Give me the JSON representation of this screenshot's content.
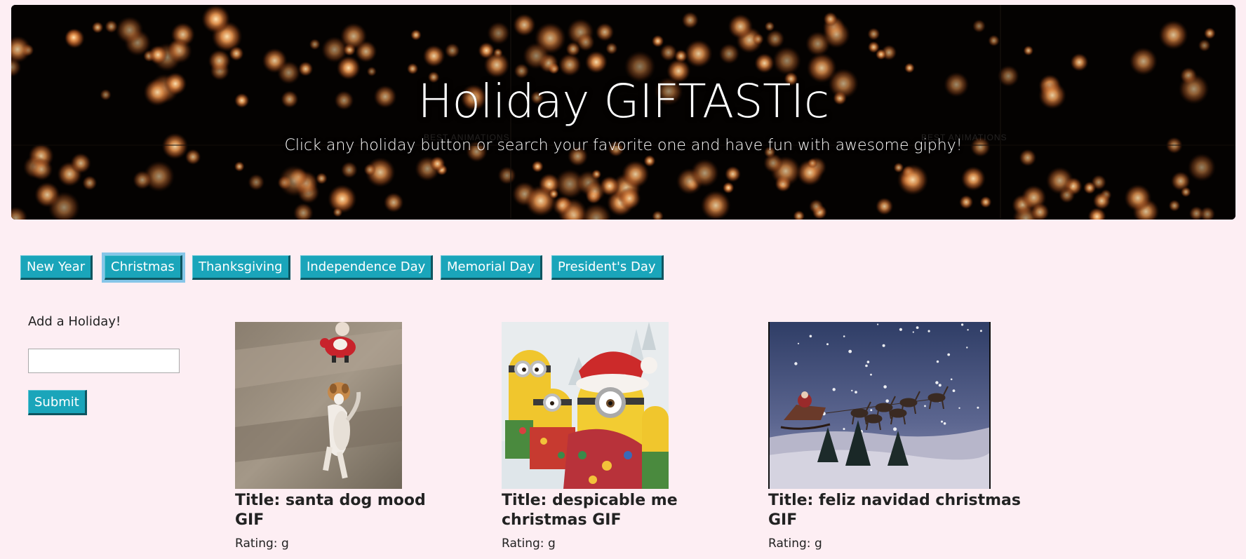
{
  "header": {
    "title": "Holiday GIFTASTIc",
    "subtitle": "Click any holiday button or search your favorite one and have fun with awesome giphy!",
    "watermark_text": "BEST ANIMATIONS",
    "background": "fireworks"
  },
  "holiday_buttons": [
    {
      "label": "New Year",
      "active": false
    },
    {
      "label": "Christmas",
      "active": true
    },
    {
      "label": "Thanksgiving",
      "active": false
    },
    {
      "label": "Independence Day",
      "active": false
    },
    {
      "label": "Memorial Day",
      "active": false
    },
    {
      "label": "President's Day",
      "active": false
    }
  ],
  "form": {
    "label": "Add a Holiday!",
    "input_value": "",
    "submit_label": "Submit"
  },
  "gifs": [
    {
      "title": "Title: santa dog mood GIF",
      "rating": "Rating: g",
      "image": "dog-chasing-santa-toy"
    },
    {
      "title": "Title: despicable me christmas GIF",
      "rating": "Rating: g",
      "image": "minions-in-christmas-outfits"
    },
    {
      "title": "Title: feliz navidad christmas GIF",
      "rating": "Rating: g",
      "image": "santa-sleigh-reindeer-snow-night"
    }
  ],
  "colors": {
    "page_bg": "#fdeef3",
    "button_bg": "#1aa5ba",
    "button_border": "#0e5560",
    "active_outline": "#86c6e8"
  }
}
